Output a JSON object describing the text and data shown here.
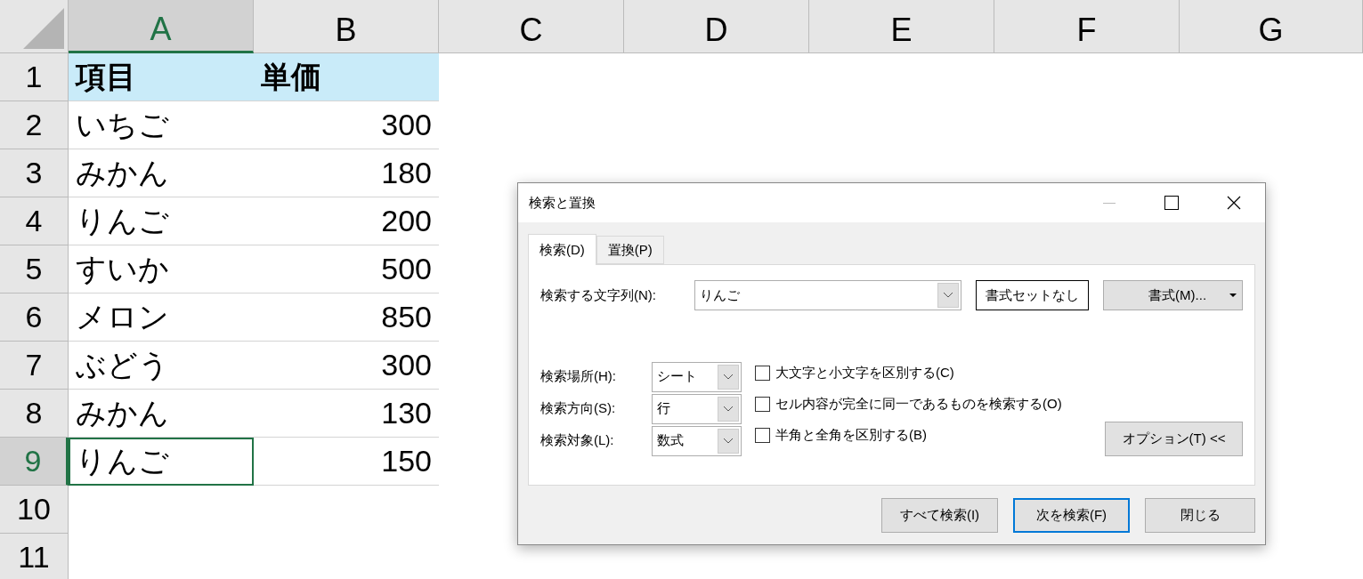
{
  "sheet": {
    "columns": [
      {
        "label": "A",
        "selected": true
      },
      {
        "label": "B",
        "selected": false
      },
      {
        "label": "C",
        "selected": false
      },
      {
        "label": "D",
        "selected": false
      },
      {
        "label": "E",
        "selected": false
      },
      {
        "label": "F",
        "selected": false
      },
      {
        "label": "G",
        "selected": false
      }
    ],
    "rows": [
      {
        "label": "1",
        "selected": false,
        "kind": "header",
        "cells": [
          {
            "text": "項目",
            "selected": false
          },
          {
            "text": "単価",
            "selected": false
          }
        ]
      },
      {
        "label": "2",
        "selected": false,
        "kind": "data",
        "cells": [
          {
            "text": "いちご",
            "selected": false
          },
          {
            "text": "300",
            "selected": false
          }
        ]
      },
      {
        "label": "3",
        "selected": false,
        "kind": "data",
        "cells": [
          {
            "text": "みかん",
            "selected": false
          },
          {
            "text": "180",
            "selected": false
          }
        ]
      },
      {
        "label": "4",
        "selected": false,
        "kind": "data",
        "cells": [
          {
            "text": "りんご",
            "selected": false
          },
          {
            "text": "200",
            "selected": false
          }
        ]
      },
      {
        "label": "5",
        "selected": false,
        "kind": "data",
        "cells": [
          {
            "text": "すいか",
            "selected": false
          },
          {
            "text": "500",
            "selected": false
          }
        ]
      },
      {
        "label": "6",
        "selected": false,
        "kind": "data",
        "cells": [
          {
            "text": "メロン",
            "selected": false
          },
          {
            "text": "850",
            "selected": false
          }
        ]
      },
      {
        "label": "7",
        "selected": false,
        "kind": "data",
        "cells": [
          {
            "text": "ぶどう",
            "selected": false
          },
          {
            "text": "300",
            "selected": false
          }
        ]
      },
      {
        "label": "8",
        "selected": false,
        "kind": "data",
        "cells": [
          {
            "text": "みかん",
            "selected": false
          },
          {
            "text": "130",
            "selected": false
          }
        ]
      },
      {
        "label": "9",
        "selected": true,
        "kind": "data",
        "cells": [
          {
            "text": "りんご",
            "selected": true
          },
          {
            "text": "150",
            "selected": false
          }
        ]
      },
      {
        "label": "10",
        "selected": false,
        "kind": "empty",
        "cells": []
      },
      {
        "label": "11",
        "selected": false,
        "kind": "empty",
        "cells": []
      }
    ]
  },
  "dialog": {
    "title": "検索と置換",
    "tabs": [
      {
        "label": "検索(D)",
        "selected": true
      },
      {
        "label": "置換(P)",
        "selected": false
      }
    ],
    "find": {
      "label": "検索する文字列(N):",
      "value": "りんご"
    },
    "format_none_button": "書式セットなし",
    "format_button": "書式(M)...",
    "options": [
      {
        "label": "検索場所(H):",
        "value": "シート"
      },
      {
        "label": "検索方向(S):",
        "value": "行"
      },
      {
        "label": "検索対象(L):",
        "value": "数式"
      }
    ],
    "checkboxes": [
      {
        "label": "大文字と小文字を区別する(C)",
        "checked": false
      },
      {
        "label": "セル内容が完全に同一であるものを検索する(O)",
        "checked": false
      },
      {
        "label": "半角と全角を区別する(B)",
        "checked": false
      }
    ],
    "options_button": "オプション(T) <<",
    "buttons": [
      {
        "label": "すべて検索(I)",
        "selected": false
      },
      {
        "label": "次を検索(F)",
        "selected": true
      },
      {
        "label": "閉じる",
        "selected": false
      }
    ]
  }
}
